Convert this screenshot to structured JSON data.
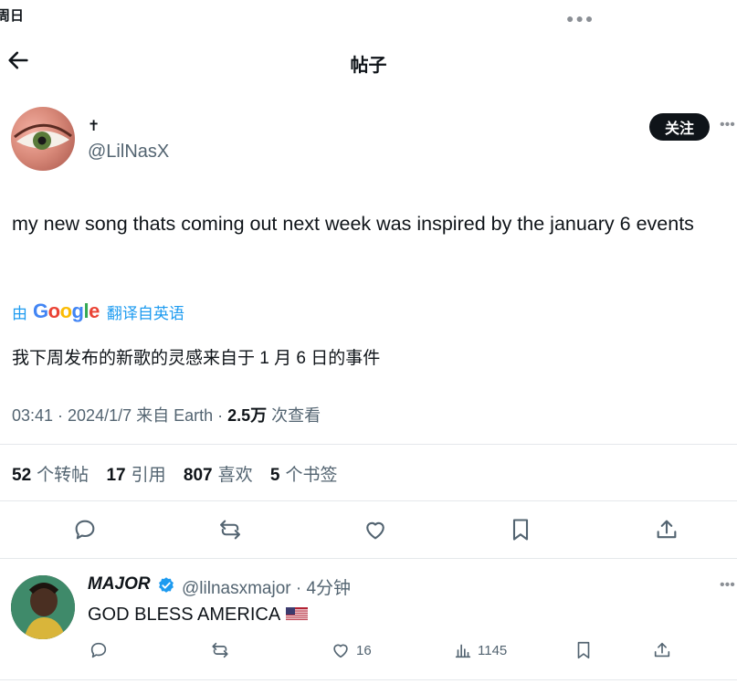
{
  "status": {
    "time_fragment": "周日"
  },
  "header": {
    "title": "帖子"
  },
  "author": {
    "name": "✝",
    "handle": "@LilNasX",
    "follow_label": "关注"
  },
  "tweet": {
    "text": "my new song thats coming out next week was inspired by the january 6 events",
    "translate_prefix": "由",
    "translate_brand": "Google",
    "translate_suffix": "翻译自英语",
    "translated_text": "我下周发布的新歌的灵感来自于 1 月 6 日的事件",
    "timestamp": "03:41 · 2024/1/7 来自 Earth · ",
    "views_value": "2.5万",
    "views_label": " 次查看"
  },
  "stats": [
    {
      "value": "52",
      "label": "个转帖"
    },
    {
      "value": "17",
      "label": "引用"
    },
    {
      "value": "807",
      "label": "喜欢"
    },
    {
      "value": "5",
      "label": "个书签"
    }
  ],
  "reply": {
    "name": "MAJOR",
    "handle": "@lilnasxmajor · 4分钟",
    "text": "GOD BLESS AMERICA",
    "likes": "16",
    "views": "1145"
  },
  "colors": {
    "accent": "#1d9bf0",
    "text": "#0f1419",
    "muted": "#536471"
  },
  "icons": [
    "back-arrow-icon",
    "reply-icon",
    "retweet-icon",
    "like-icon",
    "bookmark-icon",
    "share-icon",
    "views-icon",
    "verified-icon",
    "us-flag-icon"
  ]
}
